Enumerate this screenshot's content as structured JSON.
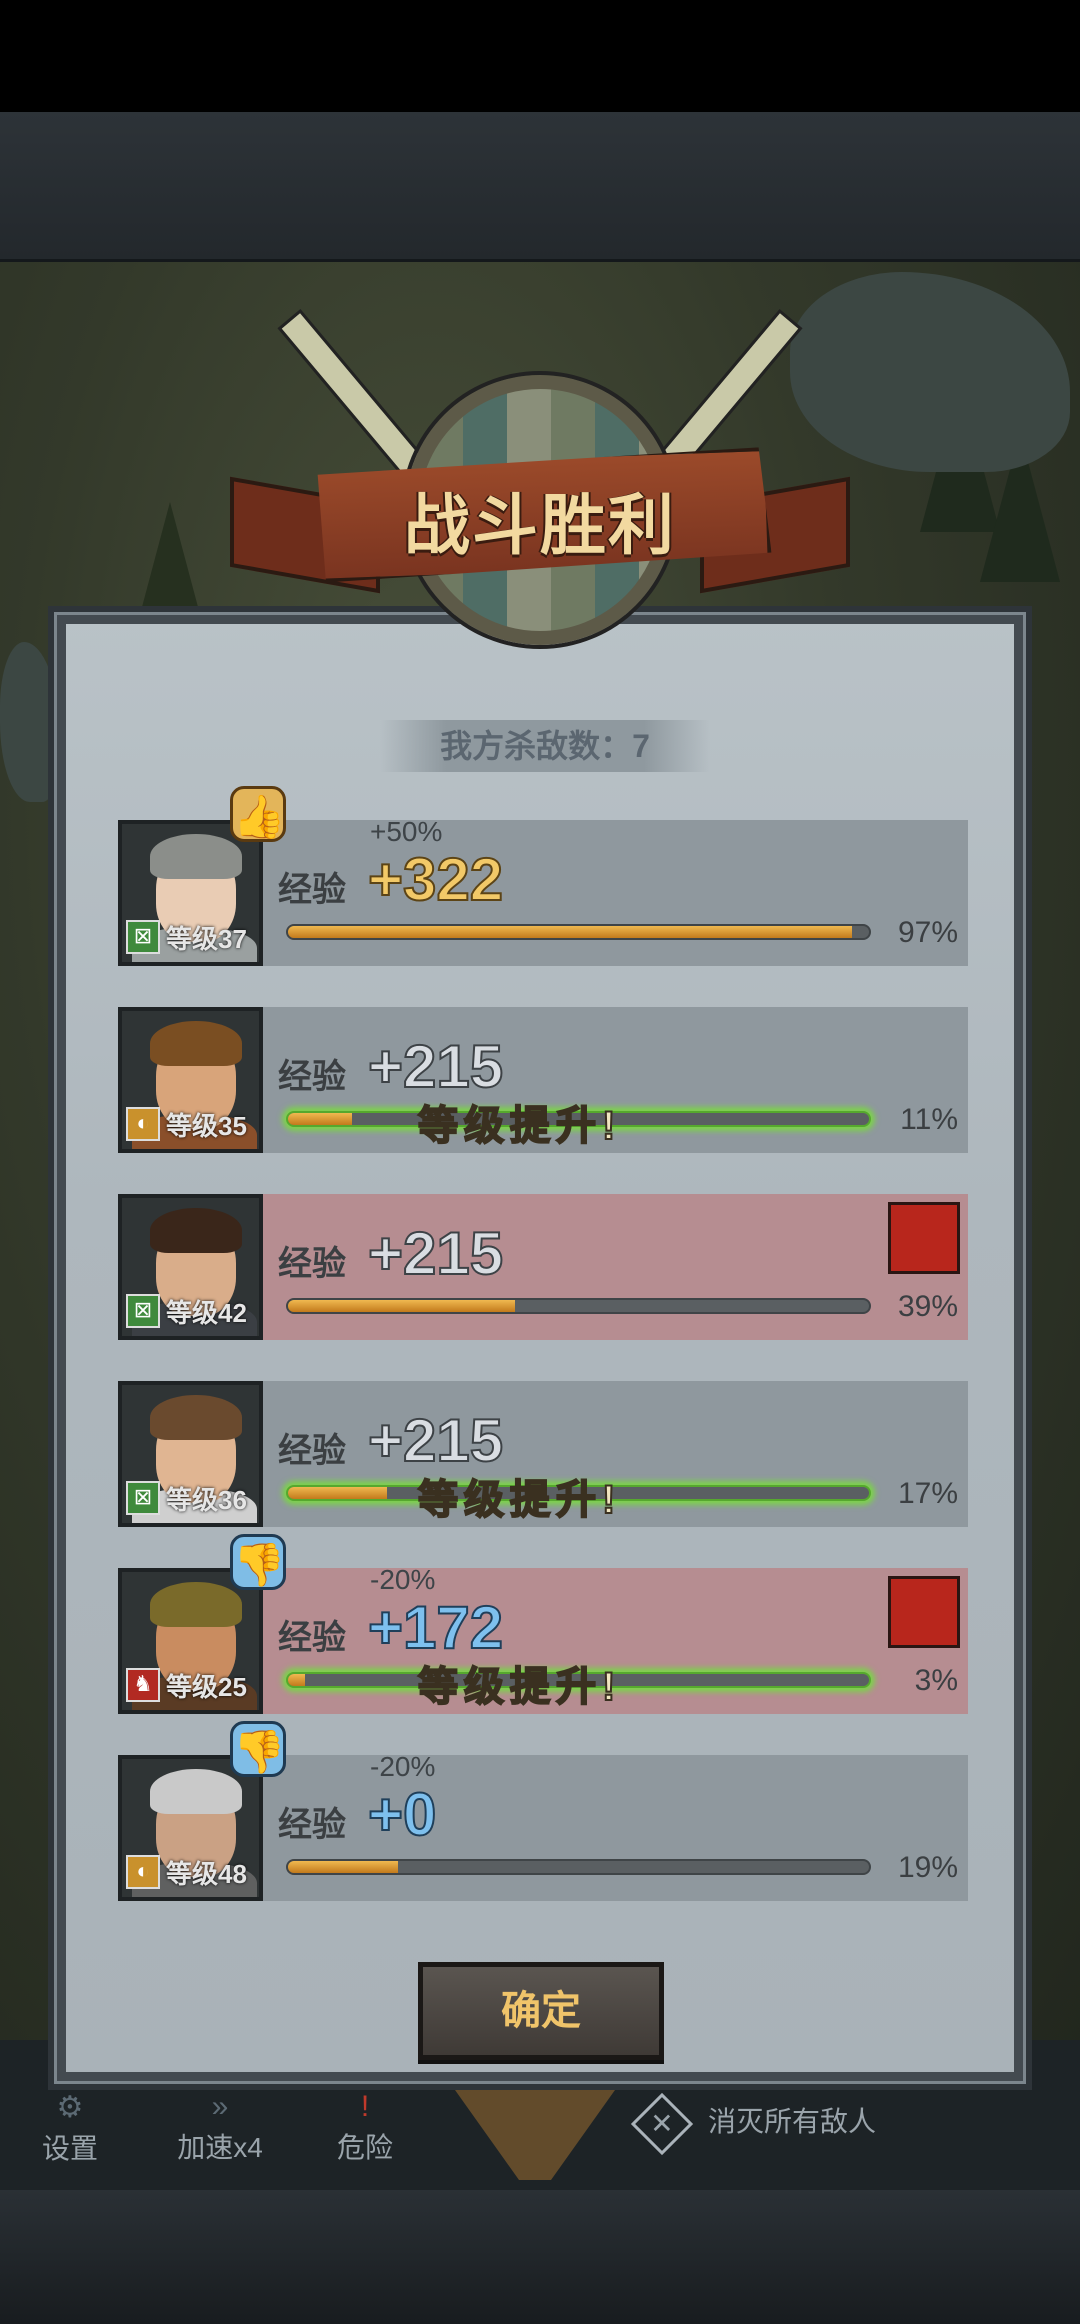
{
  "title": "战斗胜利",
  "kill_count": "我方杀敌数：7",
  "rows": [
    {
      "exp_label": "经验",
      "bonus": "+50%",
      "exp": "+322",
      "level": "等级37",
      "level_up": "",
      "percent": "97%",
      "progress": 0.97,
      "thumb": "thumbs-up",
      "red": false
    },
    {
      "exp_label": "经验",
      "bonus": "",
      "exp": "+215",
      "level": "等级35",
      "level_up": "等级提升!",
      "percent": "11%",
      "progress": 0.11,
      "thumb": "",
      "red": false
    },
    {
      "exp_label": "经验",
      "bonus": "",
      "exp": "+215",
      "level": "等级42",
      "level_up": "",
      "percent": "39%",
      "progress": 0.39,
      "thumb": "",
      "red": true
    },
    {
      "exp_label": "经验",
      "bonus": "",
      "exp": "+215",
      "level": "等级36",
      "level_up": "等级提升!",
      "percent": "17%",
      "progress": 0.17,
      "thumb": "",
      "red": false
    },
    {
      "exp_label": "经验",
      "bonus": "-20%",
      "exp": "+172",
      "level": "等级25",
      "level_up": "等级提升!",
      "percent": "3%",
      "progress": 0.03,
      "thumb": "thumbs-down",
      "red": true
    },
    {
      "exp_label": "经验",
      "bonus": "-20%",
      "exp": "+0",
      "level": "等级48",
      "level_up": "",
      "percent": "19%",
      "progress": 0.19,
      "thumb": "thumbs-down",
      "red": false
    }
  ],
  "confirm_label": "确定",
  "hud": {
    "settings": "设置",
    "speed": "加速x4",
    "danger": "危险",
    "objective": "消灭所有敌人"
  }
}
